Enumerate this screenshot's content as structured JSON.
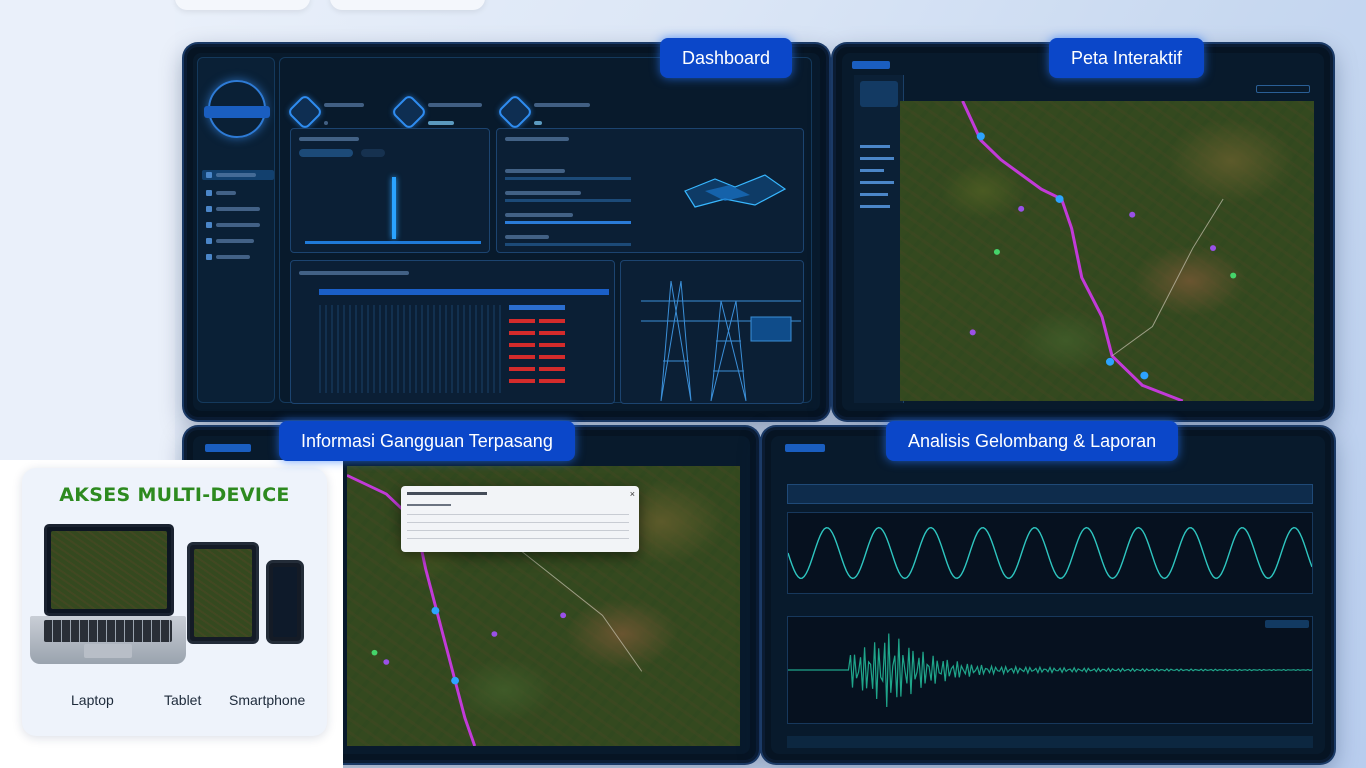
{
  "labels": {
    "dashboard": "Dashboard",
    "peta": "Peta Interaktif",
    "informasi": "Informasi Gangguan Terpasang",
    "analisis": "Analisis Gelombang & Laporan"
  },
  "multi_device": {
    "title": "AKSES MULTI-DEVICE",
    "devices": [
      "Laptop",
      "Tablet",
      "Smartphone"
    ]
  },
  "colors": {
    "label_bg": "#0b47c9",
    "map_route": "#c23ad8",
    "wave": "#2ec6c0",
    "title_green": "#2d8a1f"
  },
  "icons": [
    "dashboard-logo-icon",
    "map-marker-icon",
    "transmission-tower-icon",
    "kpi-hex-icon",
    "close-icon"
  ]
}
